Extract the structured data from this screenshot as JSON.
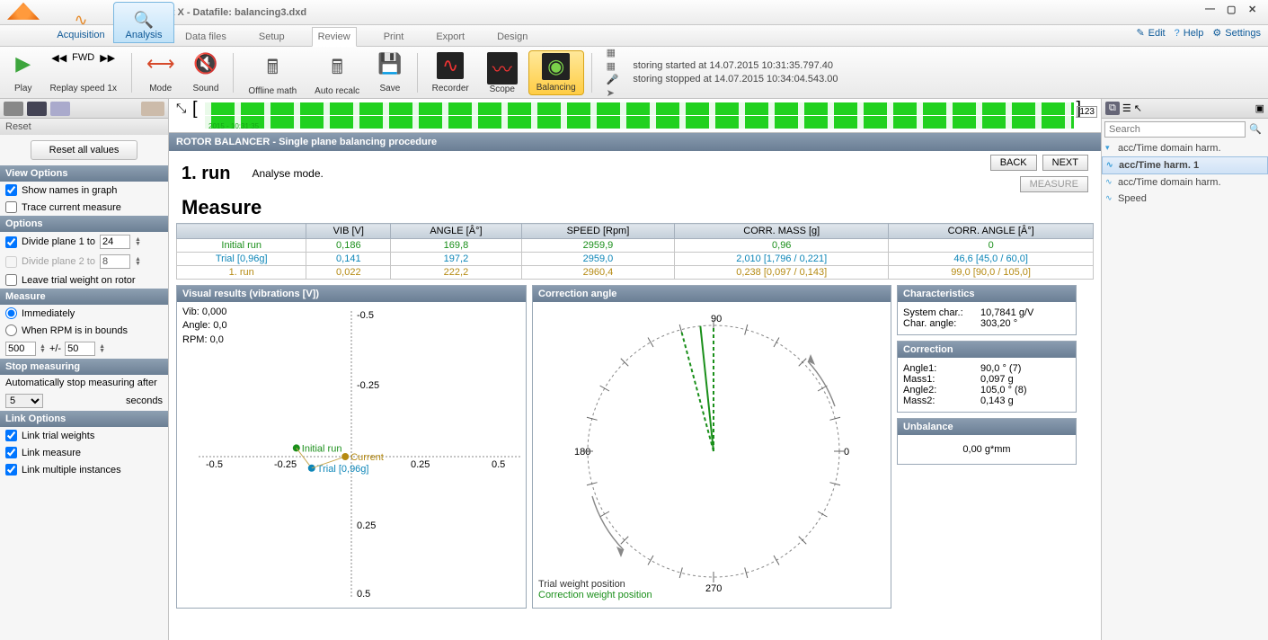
{
  "title": "DEWESoft X - Datafile: balancing3.dxd",
  "modes": {
    "acquisition": "Acquisition",
    "analysis": "Analysis"
  },
  "menus": {
    "datafiles": "Data files",
    "setup": "Setup",
    "review": "Review",
    "print": "Print",
    "export": "Export",
    "design": "Design"
  },
  "right_tools": {
    "edit": "Edit",
    "help": "Help",
    "settings": "Settings"
  },
  "toolbar": {
    "play": "Play",
    "fwd": "FWD",
    "replay": "Replay speed 1x",
    "mode": "Mode",
    "sound": "Sound",
    "offline": "Offline math",
    "autorecalc": "Auto recalc",
    "save": "Save",
    "recorder": "Recorder",
    "scope": "Scope",
    "balancing": "Balancing"
  },
  "status_lines": {
    "l1": "storing started at 14.07.2015 10:31:35.797.40",
    "l2": "storing stopped at 14.07.2015 10:34:04.543.00"
  },
  "wave_ts": "2015 - 10:31:35",
  "rotor_header": "ROTOR BALANCER - Single plane balancing procedure",
  "step_label": "1. run",
  "step_desc": "Analyse mode.",
  "measure_title": "Measure",
  "btns": {
    "back": "BACK",
    "next": "NEXT",
    "measure": "MEASURE"
  },
  "table": {
    "headers": [
      "",
      "VIB [V]",
      "ANGLE [Â°]",
      "SPEED [Rpm]",
      "CORR. MASS [g]",
      "CORR. ANGLE [Â°]"
    ],
    "rows": [
      {
        "name": "Initial run",
        "vib": "0,186",
        "angle": "169,8",
        "speed": "2959,9",
        "mass": "0,96",
        "cangle": "0",
        "cls": "row-initial"
      },
      {
        "name": "Trial [0,96g]",
        "vib": "0,141",
        "angle": "197,2",
        "speed": "2959,0",
        "mass": "2,010 [1,796 / 0,221]",
        "cangle": "46,6 [45,0 / 60,0]",
        "cls": "row-trial"
      },
      {
        "name": "1. run",
        "vib": "0,022",
        "angle": "222,2",
        "speed": "2960,4",
        "mass": "0,238 [0,097 / 0,143]",
        "cangle": "99,0 [90,0 / 105,0]",
        "cls": "row-run"
      }
    ]
  },
  "left": {
    "reset_hdr": "Reset",
    "reset": "Reset all values",
    "view": "View Options",
    "show_names": "Show names in graph",
    "trace": "Trace current measure",
    "options": "Options",
    "divide1": "Divide plane 1 to",
    "divide1_val": "24",
    "divide2": "Divide plane 2 to",
    "divide2_val": "8",
    "leave": "Leave trial weight on rotor",
    "measure": "Measure",
    "immediately": "Immediately",
    "when_rpm": "When RPM is in bounds",
    "rpm_low": "500",
    "rpm_hi": "50",
    "stop": "Stop measuring",
    "stop_desc": "Automatically stop measuring after",
    "stop_val": "5",
    "stop_unit": "seconds",
    "link": "Link Options",
    "link_trials": "Link trial weights",
    "link_measure": "Link measure",
    "link_multi": "Link multiple instances"
  },
  "panels": {
    "visual": "Visual results (vibrations [V])",
    "vib": "Vib:",
    "vib_v": "0,000",
    "angle": "Angle:",
    "angle_v": "0,0",
    "rpm": "RPM:",
    "rpm_v": "0,0",
    "corr_angle_hdr": "Correction angle",
    "trial_pos": "Trial weight position",
    "corr_pos": "Correction weight position",
    "char_hdr": "Characteristics",
    "sys_char": "System char.:",
    "sys_char_v": "10,7841 g/V",
    "char_angle": "Char. angle:",
    "char_angle_v": "303,20 °",
    "correction_hdr": "Correction",
    "a1": "Angle1:",
    "a1_v": "90,0 ° (7)",
    "m1": "Mass1:",
    "m1_v": "0,097 g",
    "a2": "Angle2:",
    "a2_v": "105,0 ° (8)",
    "m2": "Mass2:",
    "m2_v": "0,143 g",
    "unbal_hdr": "Unbalance",
    "unbal_v": "0,00 g*mm"
  },
  "right": {
    "search_ph": "Search",
    "root": "acc/Time domain harm.",
    "items": [
      "acc/Time harm. 1",
      "acc/Time domain harm.",
      "Speed"
    ]
  },
  "chart_data": {
    "visual": {
      "type": "scatter",
      "xlim": [
        -0.5,
        0.5
      ],
      "ylim": [
        -0.5,
        0.5
      ],
      "xticks": [
        -0.5,
        -0.25,
        0,
        0.25,
        0.5
      ],
      "yticks": [
        -0.5,
        -0.25,
        0,
        0.25,
        0.5
      ],
      "points": [
        {
          "name": "Initial run",
          "x": -0.18,
          "y": 0.03,
          "color": "#1a8f1a"
        },
        {
          "name": "Trial [0,96g]",
          "x": -0.13,
          "y": -0.04,
          "color": "#0d86b8"
        },
        {
          "name": "Current",
          "x": -0.02,
          "y": 0.0,
          "color": "#b58a12"
        }
      ]
    },
    "polar": {
      "type": "polar",
      "ticks_deg": [
        0,
        90,
        180,
        270
      ],
      "vectors": [
        {
          "name": "correction",
          "angle_deg": 96,
          "r": 1.0,
          "color": "#1a8f1a"
        },
        {
          "name": "split1",
          "angle_deg": 90,
          "r": 1.0,
          "color": "#1a8f1a",
          "dash": true
        },
        {
          "name": "split2",
          "angle_deg": 105,
          "r": 1.0,
          "color": "#1a8f1a",
          "dash": true
        }
      ]
    }
  }
}
